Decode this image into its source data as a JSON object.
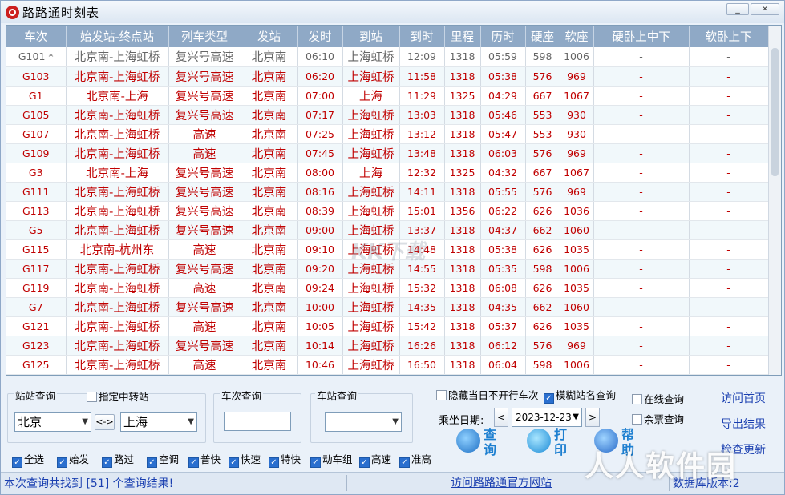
{
  "window": {
    "title": "路路通时刻表",
    "min_label": "_",
    "close_label": "×"
  },
  "table": {
    "headers": [
      "车次",
      "始发站-终点站",
      "列车类型",
      "发站",
      "发时",
      "到站",
      "到时",
      "里程",
      "历时",
      "硬座",
      "软座",
      "硬卧上中下",
      "软卧上下"
    ],
    "rows": [
      [
        "G101 *",
        "北京南-上海虹桥",
        "复兴号高速",
        "北京南",
        "06:10",
        "上海虹桥",
        "12:09",
        "1318",
        "05:59",
        "598",
        "1006",
        "-",
        "-"
      ],
      [
        "G103",
        "北京南-上海虹桥",
        "复兴号高速",
        "北京南",
        "06:20",
        "上海虹桥",
        "11:58",
        "1318",
        "05:38",
        "576",
        "969",
        "-",
        "-"
      ],
      [
        "G1",
        "北京南-上海",
        "复兴号高速",
        "北京南",
        "07:00",
        "上海",
        "11:29",
        "1325",
        "04:29",
        "667",
        "1067",
        "-",
        "-"
      ],
      [
        "G105",
        "北京南-上海虹桥",
        "复兴号高速",
        "北京南",
        "07:17",
        "上海虹桥",
        "13:03",
        "1318",
        "05:46",
        "553",
        "930",
        "-",
        "-"
      ],
      [
        "G107",
        "北京南-上海虹桥",
        "高速",
        "北京南",
        "07:25",
        "上海虹桥",
        "13:12",
        "1318",
        "05:47",
        "553",
        "930",
        "-",
        "-"
      ],
      [
        "G109",
        "北京南-上海虹桥",
        "高速",
        "北京南",
        "07:45",
        "上海虹桥",
        "13:48",
        "1318",
        "06:03",
        "576",
        "969",
        "-",
        "-"
      ],
      [
        "G3",
        "北京南-上海",
        "复兴号高速",
        "北京南",
        "08:00",
        "上海",
        "12:32",
        "1325",
        "04:32",
        "667",
        "1067",
        "-",
        "-"
      ],
      [
        "G111",
        "北京南-上海虹桥",
        "复兴号高速",
        "北京南",
        "08:16",
        "上海虹桥",
        "14:11",
        "1318",
        "05:55",
        "576",
        "969",
        "-",
        "-"
      ],
      [
        "G113",
        "北京南-上海虹桥",
        "复兴号高速",
        "北京南",
        "08:39",
        "上海虹桥",
        "15:01",
        "1356",
        "06:22",
        "626",
        "1036",
        "-",
        "-"
      ],
      [
        "G5",
        "北京南-上海虹桥",
        "复兴号高速",
        "北京南",
        "09:00",
        "上海虹桥",
        "13:37",
        "1318",
        "04:37",
        "662",
        "1060",
        "-",
        "-"
      ],
      [
        "G115",
        "北京南-杭州东",
        "高速",
        "北京南",
        "09:10",
        "上海虹桥",
        "14:48",
        "1318",
        "05:38",
        "626",
        "1035",
        "-",
        "-"
      ],
      [
        "G117",
        "北京南-上海虹桥",
        "复兴号高速",
        "北京南",
        "09:20",
        "上海虹桥",
        "14:55",
        "1318",
        "05:35",
        "598",
        "1006",
        "-",
        "-"
      ],
      [
        "G119",
        "北京南-上海虹桥",
        "高速",
        "北京南",
        "09:24",
        "上海虹桥",
        "15:32",
        "1318",
        "06:08",
        "626",
        "1035",
        "-",
        "-"
      ],
      [
        "G7",
        "北京南-上海虹桥",
        "复兴号高速",
        "北京南",
        "10:00",
        "上海虹桥",
        "14:35",
        "1318",
        "04:35",
        "662",
        "1060",
        "-",
        "-"
      ],
      [
        "G121",
        "北京南-上海虹桥",
        "高速",
        "北京南",
        "10:05",
        "上海虹桥",
        "15:42",
        "1318",
        "05:37",
        "626",
        "1035",
        "-",
        "-"
      ],
      [
        "G123",
        "北京南-上海虹桥",
        "复兴号高速",
        "北京南",
        "10:14",
        "上海虹桥",
        "16:26",
        "1318",
        "06:12",
        "576",
        "969",
        "-",
        "-"
      ],
      [
        "G125",
        "北京南-上海虹桥",
        "高速",
        "北京南",
        "10:46",
        "上海虹桥",
        "16:50",
        "1318",
        "06:04",
        "598",
        "1006",
        "-",
        "-"
      ]
    ]
  },
  "watermark": "KK下载",
  "station_query": {
    "label": "站站查询",
    "transfer_label": "指定中转站",
    "from": "北京",
    "to": "上海",
    "swap_label": "<->"
  },
  "train_query": {
    "label": "车次查询",
    "value": ""
  },
  "station_lookup": {
    "label": "车站查询",
    "value": ""
  },
  "options": {
    "hide_label": "隐藏当日不开行车次",
    "fuzzy_label": "模糊站名查询",
    "online_label": "在线查询",
    "tickets_label": "余票查询"
  },
  "date": {
    "label": "乘坐日期:",
    "value": "2023-12-23",
    "prev": "<",
    "next": ">"
  },
  "filters": [
    "全选",
    "始发",
    "路过",
    "空调",
    "普快",
    "快速",
    "特快",
    "动车组",
    "高速",
    "准高"
  ],
  "buttons": {
    "query": "查询",
    "print": "打印",
    "help": "帮助"
  },
  "links": {
    "home": "访问首页",
    "export": "导出结果",
    "update": "检查更新"
  },
  "status": {
    "result_text": "本次查询共找到 [51] 个查询结果!",
    "site_link": "访问路路通官方网站",
    "version_text": "数据库版本:2"
  },
  "brand": "人人软件园",
  "colors": {
    "header": "#8fa9c6",
    "train_text": "#c00000",
    "link": "#1a3fb0"
  }
}
